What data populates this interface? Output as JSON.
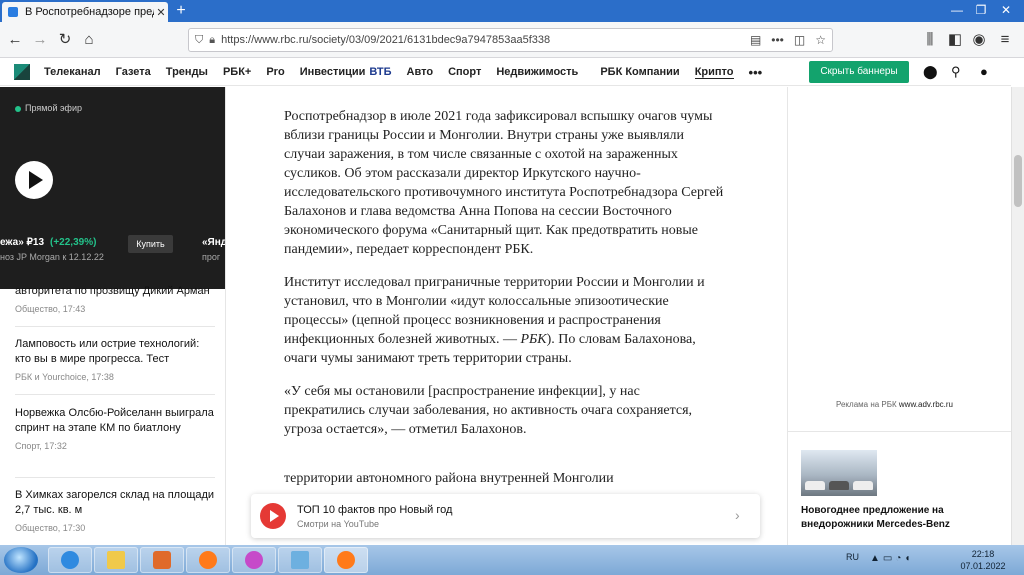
{
  "browser": {
    "tab_title": "В Роспотребнадзоре предупр",
    "url": "https://www.rbc.ru/society/03/09/2021/6131bdec9a7947853aa5f338"
  },
  "site_nav": {
    "items": [
      "Телеканал",
      "Газета",
      "Тренды",
      "РБК+",
      "Pro",
      "Инвестиции"
    ],
    "vtb": "ВТБ",
    "items2": [
      "Авто",
      "Спорт",
      "Недвижимость",
      "РБК Компании",
      "Крипто"
    ],
    "more": "•••",
    "banner_button": "Скрыть баннеры"
  },
  "live": {
    "label": "Прямой эфир",
    "ticker_a": "ежа» ₽13",
    "ticker_change": "(+22,39%)",
    "ticker_b": "ноз JP Morgan к 12.12.22",
    "buy": "Купить",
    "ticker_c": "«Янд",
    "ticker_d": "прог"
  },
  "news": [
    {
      "title": "авторитета по прозвищу Дикий Арман",
      "meta": "Общество, 17:43"
    },
    {
      "title": "Ламповость или острие технологий: кто вы в мире прогресса. Тест",
      "meta": "РБК и Yourchoice, 17:38"
    },
    {
      "title": "Норвежка Олсбю-Ройселанн выиграла спринт на этапе КМ по биатлону",
      "meta": "Спорт, 17:32"
    },
    {
      "title": "В Химках загорелся склад на площади 2,7 тыс. кв. м",
      "meta": "Общество, 17:30"
    }
  ],
  "article": {
    "p1": "Роспотребнадзор в июле 2021 года зафиксировал вспышку очагов чумы вблизи границы России и Монголии. Внутри страны уже выявляли случаи заражения, в том числе связанные с охотой на зараженных сусликов. Об этом рассказали директор Иркутского научно-исследовательского противочумного института Роспотребнадзора Сергей Балахонов и глава ведомства Анна Попова на сессии Восточного экономического форума «Санитарный щит. Как предотвратить новые пандемии», передает корреспондент РБК.",
    "p2a": "Институт исследовал приграничные территории России и Монголии и установил, что в Монголии «идут колоссальные эпизоотические процессы» (цепной процесс возникновения и распространения инфекционных болезней животных. — ",
    "p2b": "РБК",
    "p2c": "). По словам Балахонова, очаги чумы занимают треть территории страны.",
    "p3": "«У себя мы остановили [распространение инфекции], у нас прекратились случаи заболевания, но активность очага сохраняется, угроза остается», — отметил Балахонов.",
    "p4": "территории автономного района внутренней Монголии"
  },
  "ad": {
    "label": "Реклама на РБК",
    "domain": "www.adv.rbc.ru",
    "title": "Новогоднее предложение на внедорожники Mercedes-Benz"
  },
  "youtube": {
    "title": "ТОП 10 фактов про Новый год",
    "subtitle": "Смотри на YouTube"
  },
  "taskbar": {
    "lang": "RU",
    "time": "22:18",
    "date": "07.01.2022"
  },
  "colors": {
    "accent": "#13a36d",
    "tabbar": "#2b6ec9",
    "vtb": "#1d3a8e"
  }
}
